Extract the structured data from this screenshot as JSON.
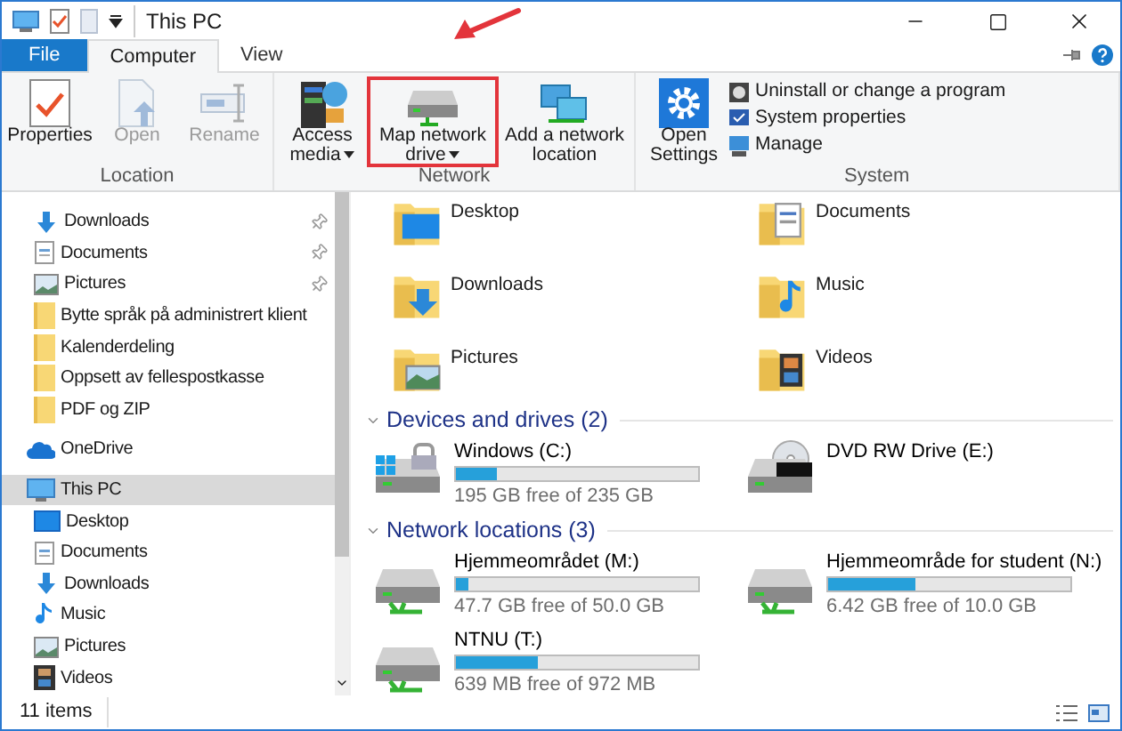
{
  "window": {
    "title": "This PC"
  },
  "tabs": [
    {
      "label": "File",
      "kind": "file",
      "selected": false
    },
    {
      "label": "Computer",
      "kind": "tab",
      "selected": true
    },
    {
      "label": "View",
      "kind": "tab",
      "selected": false
    }
  ],
  "annotation_arrow": true,
  "ribbon": [
    {
      "label": "Location",
      "buttons": [
        {
          "label": "Properties",
          "kind": "properties",
          "disabled": false,
          "dropdown": false,
          "highlighted": false
        },
        {
          "label": "Open",
          "kind": "open",
          "disabled": true,
          "dropdown": false,
          "highlighted": false
        },
        {
          "label": "Rename",
          "kind": "rename",
          "disabled": true,
          "dropdown": false,
          "highlighted": false
        }
      ]
    },
    {
      "label": "Network",
      "buttons": [
        {
          "label": "Access media",
          "kind": "media",
          "disabled": false,
          "dropdown": true,
          "highlighted": false
        },
        {
          "label": "Map network drive",
          "kind": "netdrive",
          "disabled": false,
          "dropdown": true,
          "highlighted": true
        },
        {
          "label": "Add a network location",
          "kind": "netlocation",
          "disabled": false,
          "dropdown": false,
          "highlighted": false
        }
      ]
    },
    {
      "label": "System",
      "buttons": [
        {
          "label": "Open Settings",
          "kind": "settings",
          "disabled": false,
          "dropdown": false,
          "highlighted": false
        }
      ],
      "small_buttons": [
        {
          "label": "Uninstall or change a program",
          "kind": "uninstall"
        },
        {
          "label": "System properties",
          "kind": "sysprops"
        },
        {
          "label": "Manage",
          "kind": "manage"
        }
      ]
    }
  ],
  "sidebar": {
    "quick_access": [
      {
        "label": "Downloads",
        "kind": "downloads",
        "pinned": true,
        "selected": false
      },
      {
        "label": "Documents",
        "kind": "documents",
        "pinned": true,
        "selected": false
      },
      {
        "label": "Pictures",
        "kind": "pictures",
        "pinned": true,
        "selected": false
      },
      {
        "label": "Bytte språk på administrert klient",
        "kind": "folder",
        "pinned": false,
        "selected": false
      },
      {
        "label": "Kalenderdeling",
        "kind": "folder",
        "pinned": false,
        "selected": false
      },
      {
        "label": "Oppsett av fellespostkasse",
        "kind": "folder",
        "pinned": false,
        "selected": false
      },
      {
        "label": "PDF og ZIP",
        "kind": "folder",
        "pinned": false,
        "selected": false
      }
    ],
    "items": [
      {
        "label": "OneDrive",
        "kind": "onedrive",
        "selected": false
      },
      {
        "label": "This PC",
        "kind": "pc",
        "selected": true,
        "children": [
          {
            "label": "Desktop",
            "kind": "desktop",
            "selected": false
          },
          {
            "label": "Documents",
            "kind": "documents",
            "selected": false
          },
          {
            "label": "Downloads",
            "kind": "downloads",
            "selected": false
          },
          {
            "label": "Music",
            "kind": "music",
            "selected": false
          },
          {
            "label": "Pictures",
            "kind": "pictures",
            "selected": false
          },
          {
            "label": "Videos",
            "kind": "videos",
            "selected": false
          }
        ]
      }
    ]
  },
  "folders": [
    {
      "label": "Desktop",
      "kind": "desktop"
    },
    {
      "label": "Documents",
      "kind": "documents"
    },
    {
      "label": "Downloads",
      "kind": "downloads"
    },
    {
      "label": "Music",
      "kind": "music"
    },
    {
      "label": "Pictures",
      "kind": "pictures"
    },
    {
      "label": "Videos",
      "kind": "videos"
    }
  ],
  "sections": [
    {
      "title": "Devices and drives (2)",
      "drives": [
        {
          "name": "Windows (C:)",
          "kind": "system",
          "level": 0.17,
          "free": "195 GB free of 235 GB"
        },
        {
          "name": "DVD RW Drive (E:)",
          "kind": "dvd"
        }
      ]
    },
    {
      "title": "Network locations (3)",
      "drives": [
        {
          "name": "Hjemmeområdet (M:)",
          "kind": "network",
          "level": 0.05,
          "free": "47.7 GB free of 50.0 GB"
        },
        {
          "name": "Hjemmeområde for student (N:)",
          "kind": "network",
          "level": 0.36,
          "free": "6.42 GB free of 10.0 GB"
        },
        {
          "name": "NTNU (T:)",
          "kind": "network",
          "level": 0.34,
          "free": "639 MB free of 972 MB"
        }
      ]
    }
  ],
  "status_bar": {
    "count": "11 items"
  }
}
